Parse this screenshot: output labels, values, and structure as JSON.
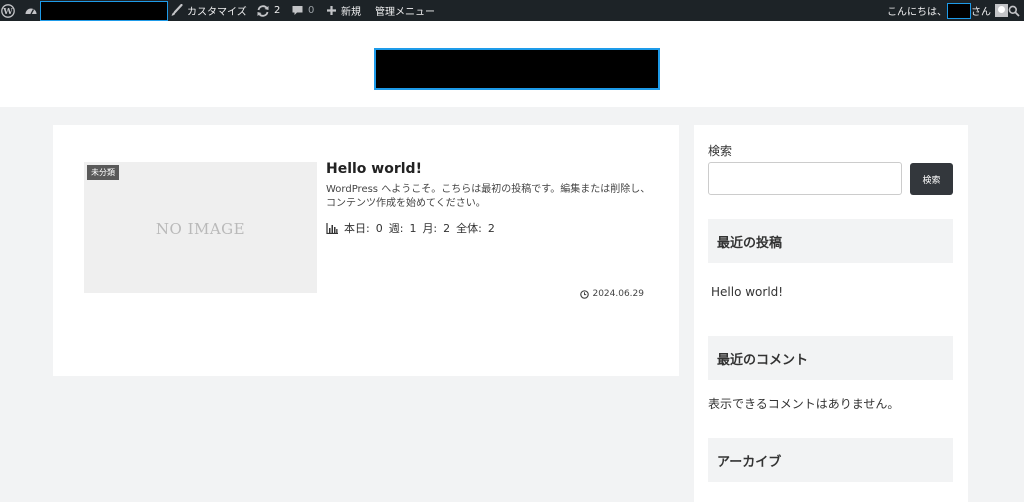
{
  "admin_bar": {
    "customize_label": "カスタマイズ",
    "updates_count": "2",
    "comments_count": "0",
    "new_label": "新規",
    "admin_menu_label": "管理メニュー",
    "greeting": "こんにちは、",
    "greeting_suffix": "さん"
  },
  "post": {
    "category": "未分類",
    "thumbnail_text": "NO IMAGE",
    "title": "Hello world!",
    "excerpt": "WordPress へようこそ。こちらは最初の投稿です。編集または削除し、コンテンツ作成を始めてください。",
    "pageviews": {
      "today_label": "本日:",
      "today": "0",
      "week_label": "週:",
      "week": "1",
      "month_label": "月:",
      "month": "2",
      "total_label": "全体:",
      "total": "2"
    },
    "date": "2024.06.29"
  },
  "sidebar": {
    "search_label": "検索",
    "search_value": "",
    "search_button": "検索",
    "recent_posts_title": "最近の投稿",
    "recent_post_1": "Hello world!",
    "recent_comments_title": "最近のコメント",
    "no_comments_text": "表示できるコメントはありません。",
    "archive_title": "アーカイブ"
  },
  "colors": {
    "admin_bar_bg": "#1d2327",
    "page_bg": "#f2f3f4",
    "redaction_border": "#1e9be9",
    "button_bg": "#33373c"
  }
}
